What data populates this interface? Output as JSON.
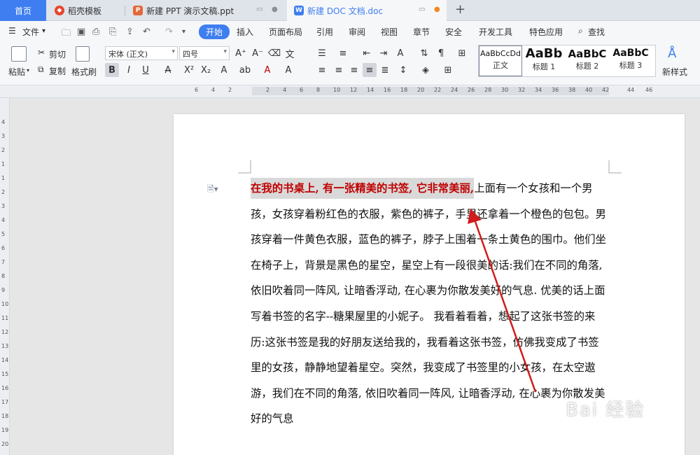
{
  "tabs": {
    "home": "首页",
    "template": "稻壳模板",
    "ppt": "新建 PPT 演示文稿.ppt",
    "doc": "新建 DOC 文档.doc",
    "add": "+"
  },
  "menu": {
    "file": "文件",
    "items": [
      "开始",
      "插入",
      "页面布局",
      "引用",
      "审阅",
      "视图",
      "章节",
      "安全",
      "开发工具",
      "特色应用"
    ],
    "search": "查找"
  },
  "ribbon": {
    "paste": "粘贴",
    "cut": "剪切",
    "copy": "复制",
    "format_painter": "格式刷",
    "font_name": "宋体 (正文)",
    "font_size": "四号",
    "new_style": "新样式",
    "styles": [
      {
        "preview": "AaBbCcDd",
        "name": "正文"
      },
      {
        "preview": "AaBb",
        "name": "标题 1"
      },
      {
        "preview": "AaBbC",
        "name": "标题 2"
      },
      {
        "preview": "AaBbC",
        "name": "标题 3"
      }
    ]
  },
  "ruler": {
    "h_ticks": [
      "6",
      "4",
      "2",
      "2",
      "4",
      "6",
      "8",
      "10",
      "12",
      "14",
      "16",
      "18",
      "20",
      "22",
      "24",
      "26",
      "28",
      "30",
      "32",
      "34",
      "36",
      "38",
      "40",
      "42",
      "44",
      "46"
    ],
    "v_ticks": [
      "4",
      "3",
      "2",
      "1",
      "1",
      "2",
      "3",
      "4",
      "5",
      "6",
      "7",
      "8",
      "9",
      "10",
      "11",
      "12",
      "13",
      "14",
      "15",
      "16",
      "17",
      "18",
      "19",
      "20"
    ]
  },
  "document": {
    "highlighted": "在我的书桌上, 有一张精美的书签, 它非常美丽,",
    "body": "上面有一个女孩和一个男孩，女孩穿着粉红色的衣服，紫色的裤子，手里还拿着一个橙色的包包。男孩穿着一件黄色衣服，蓝色的裤子，脖子上围着一条土黄色的围巾。他们坐在椅子上，背景是黑色的星空，星空上有一段很美的话:我们在不同的角落, 依旧吹着同一阵风, 让暗香浮动, 在心裹为你散发美好的气息. 优美的话上面写着书签的名字--糖果屋里的小妮子。 我看着看着，想起了这张书签的来历:这张书签是我的好朋友送给我的，我看着这张书签，仿佛我变成了书签里的女孩，静静地望着星空。突然，我变成了书签里的小女孩，在太空遨游，我们在不同的角落, 依旧吹着同一阵风, 让暗香浮动, 在心裹为你散发美好的气息"
  },
  "colors": {
    "accent": "#3e7ef0",
    "highlight_text": "#c00000",
    "arrow": "#d01c1c"
  }
}
